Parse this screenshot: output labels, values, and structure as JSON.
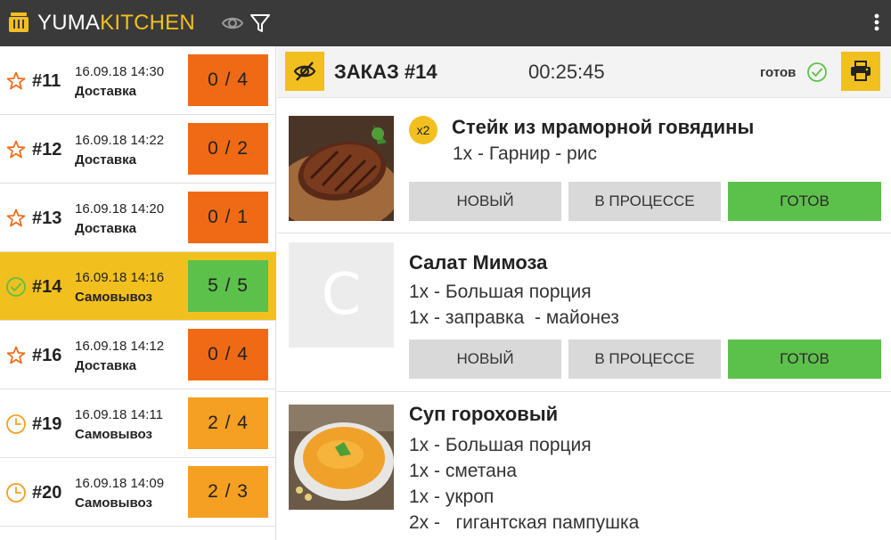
{
  "app": {
    "brand_part1": "YUMA",
    "brand_part2": "KITCHEN"
  },
  "colors": {
    "accent": "#f2c01e",
    "topbar": "#3a3a3a",
    "count_red": "#f06a16",
    "count_orange": "#f5a022",
    "count_green": "#5cc14a"
  },
  "sidebar": {
    "orders": [
      {
        "icon": "star-icon",
        "num": "#11",
        "datetime": "16.09.18 14:30",
        "type": "Доставка",
        "count": "0 / 4",
        "status": "red",
        "active": false
      },
      {
        "icon": "star-icon",
        "num": "#12",
        "datetime": "16.09.18 14:22",
        "type": "Доставка",
        "count": "0 / 2",
        "status": "red",
        "active": false
      },
      {
        "icon": "star-icon",
        "num": "#13",
        "datetime": "16.09.18 14:20",
        "type": "Доставка",
        "count": "0 / 1",
        "status": "red",
        "active": false
      },
      {
        "icon": "check-circle-icon",
        "num": "#14",
        "datetime": "16.09.18 14:16",
        "type": "Самовывоз",
        "count": "5 / 5",
        "status": "green",
        "active": true
      },
      {
        "icon": "star-icon",
        "num": "#16",
        "datetime": "16.09.18 14:12",
        "type": "Доставка",
        "count": "0 / 4",
        "status": "red",
        "active": false
      },
      {
        "icon": "clock-icon",
        "num": "#19",
        "datetime": "16.09.18 14:11",
        "type": "Самовывоз",
        "count": "2 / 4",
        "status": "orange",
        "active": false
      },
      {
        "icon": "clock-icon",
        "num": "#20",
        "datetime": "16.09.18 14:09",
        "type": "Самовывоз",
        "count": "2 / 3",
        "status": "orange",
        "active": false
      }
    ]
  },
  "header": {
    "title": "ЗАКАЗ #14",
    "timer": "00:25:45",
    "ready_label": "готов"
  },
  "items": [
    {
      "name": "Стейк из мраморной говядины",
      "qty_badge": "x2",
      "mods": [
        "1x - Гарнир - рис"
      ],
      "image": "steak-photo",
      "buttons": [
        "НОВЫЙ",
        "В ПРОЦЕССЕ",
        "ГОТОВ"
      ],
      "active_status": "ГОТОВ"
    },
    {
      "name": "Салат Мимоза",
      "placeholder_letter": "C",
      "mods": [
        "1x - Большая порция",
        "1x - заправка  - майонез"
      ],
      "image": "placeholder",
      "buttons": [
        "НОВЫЙ",
        "В ПРОЦЕССЕ",
        "ГОТОВ"
      ],
      "active_status": "ГОТОВ"
    },
    {
      "name": "Суп гороховый",
      "mods": [
        "1x - Большая порция",
        "1x - сметана",
        "1x - укроп",
        "2x -   гигантская пампушка"
      ],
      "image": "soup-photo"
    }
  ]
}
